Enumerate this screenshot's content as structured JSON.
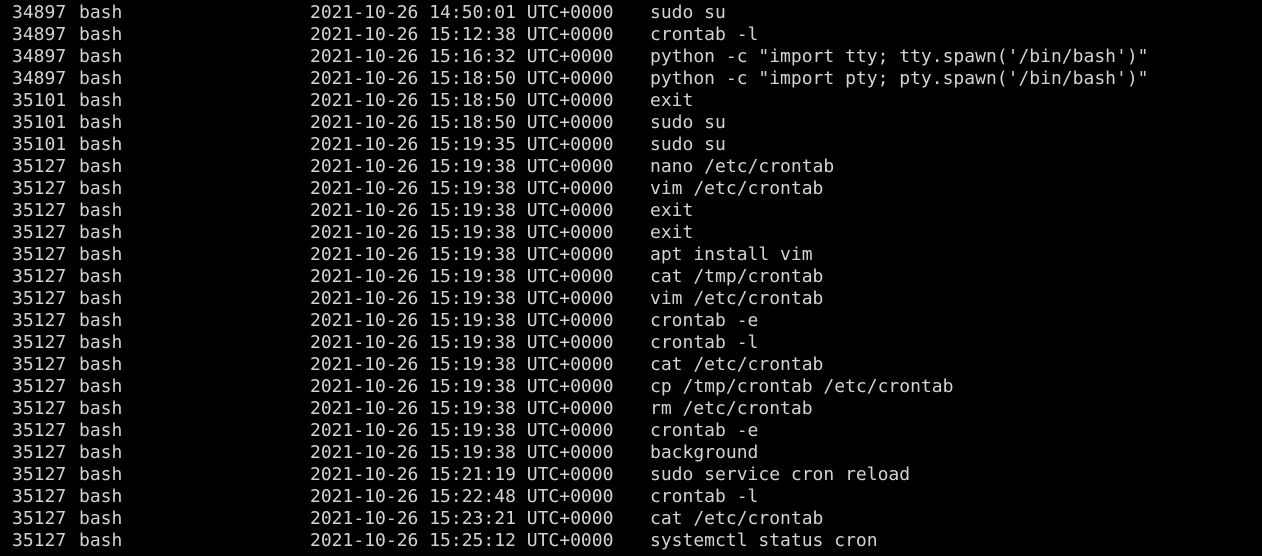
{
  "colors": {
    "background": "#000000",
    "foreground": "#d3d3d3"
  },
  "rows": [
    {
      "pid": "34897",
      "process": "bash",
      "time": "2021-10-26 14:50:01 UTC+0000",
      "command": "sudo su"
    },
    {
      "pid": "34897",
      "process": "bash",
      "time": "2021-10-26 15:12:38 UTC+0000",
      "command": "crontab -l"
    },
    {
      "pid": "34897",
      "process": "bash",
      "time": "2021-10-26 15:16:32 UTC+0000",
      "command": "python -c \"import tty; tty.spawn('/bin/bash')\""
    },
    {
      "pid": "34897",
      "process": "bash",
      "time": "2021-10-26 15:18:50 UTC+0000",
      "command": "python -c \"import pty; pty.spawn('/bin/bash')\""
    },
    {
      "pid": "35101",
      "process": "bash",
      "time": "2021-10-26 15:18:50 UTC+0000",
      "command": "exit"
    },
    {
      "pid": "35101",
      "process": "bash",
      "time": "2021-10-26 15:18:50 UTC+0000",
      "command": "sudo su"
    },
    {
      "pid": "35101",
      "process": "bash",
      "time": "2021-10-26 15:19:35 UTC+0000",
      "command": "sudo su"
    },
    {
      "pid": "35127",
      "process": "bash",
      "time": "2021-10-26 15:19:38 UTC+0000",
      "command": "nano /etc/crontab"
    },
    {
      "pid": "35127",
      "process": "bash",
      "time": "2021-10-26 15:19:38 UTC+0000",
      "command": "vim /etc/crontab"
    },
    {
      "pid": "35127",
      "process": "bash",
      "time": "2021-10-26 15:19:38 UTC+0000",
      "command": "exit"
    },
    {
      "pid": "35127",
      "process": "bash",
      "time": "2021-10-26 15:19:38 UTC+0000",
      "command": "exit"
    },
    {
      "pid": "35127",
      "process": "bash",
      "time": "2021-10-26 15:19:38 UTC+0000",
      "command": "apt install vim"
    },
    {
      "pid": "35127",
      "process": "bash",
      "time": "2021-10-26 15:19:38 UTC+0000",
      "command": "cat /tmp/crontab"
    },
    {
      "pid": "35127",
      "process": "bash",
      "time": "2021-10-26 15:19:38 UTC+0000",
      "command": "vim /etc/crontab"
    },
    {
      "pid": "35127",
      "process": "bash",
      "time": "2021-10-26 15:19:38 UTC+0000",
      "command": "crontab -e"
    },
    {
      "pid": "35127",
      "process": "bash",
      "time": "2021-10-26 15:19:38 UTC+0000",
      "command": "crontab -l"
    },
    {
      "pid": "35127",
      "process": "bash",
      "time": "2021-10-26 15:19:38 UTC+0000",
      "command": "cat /etc/crontab"
    },
    {
      "pid": "35127",
      "process": "bash",
      "time": "2021-10-26 15:19:38 UTC+0000",
      "command": "cp /tmp/crontab /etc/crontab"
    },
    {
      "pid": "35127",
      "process": "bash",
      "time": "2021-10-26 15:19:38 UTC+0000",
      "command": "rm /etc/crontab"
    },
    {
      "pid": "35127",
      "process": "bash",
      "time": "2021-10-26 15:19:38 UTC+0000",
      "command": "crontab -e"
    },
    {
      "pid": "35127",
      "process": "bash",
      "time": "2021-10-26 15:19:38 UTC+0000",
      "command": "background"
    },
    {
      "pid": "35127",
      "process": "bash",
      "time": "2021-10-26 15:21:19 UTC+0000",
      "command": "sudo service cron reload"
    },
    {
      "pid": "35127",
      "process": "bash",
      "time": "2021-10-26 15:22:48 UTC+0000",
      "command": "crontab -l"
    },
    {
      "pid": "35127",
      "process": "bash",
      "time": "2021-10-26 15:23:21 UTC+0000",
      "command": "cat /etc/crontab"
    },
    {
      "pid": "35127",
      "process": "bash",
      "time": "2021-10-26 15:25:12 UTC+0000",
      "command": "systemctl status cron"
    }
  ]
}
